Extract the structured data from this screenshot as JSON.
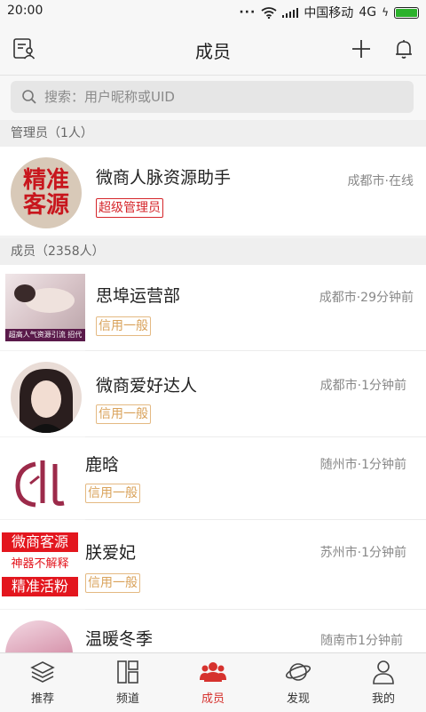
{
  "status_bar": {
    "time": "20:00",
    "carrier": "中国移动",
    "network": "4G"
  },
  "header": {
    "title": "成员"
  },
  "search": {
    "placeholder": "搜索：用户昵称或UID"
  },
  "sections": {
    "admins": "管理员（1人）",
    "members": "成员（2358人）"
  },
  "admin": {
    "avatar_text": [
      "精准",
      "客源"
    ],
    "name": "微商人脉资源助手",
    "meta": "成都市·在线",
    "badge": "超级管理员"
  },
  "members": [
    {
      "name": "思埠运营部",
      "meta": "成都市·29分钟前",
      "badge": "信用一般",
      "avatar_caption": "超高人气资源引流 招代"
    },
    {
      "name": "微商爱好达人",
      "meta": "成都市·1分钟前",
      "badge": "信用一般"
    },
    {
      "name": "鹿晗",
      "meta": "随州市·1分钟前",
      "badge": "信用一般"
    },
    {
      "name": "朕爱妃",
      "meta": "苏州市·1分钟前",
      "badge": "信用一般",
      "avatar_lines": [
        "微商客源",
        "神器不解释",
        "精准活粉"
      ]
    },
    {
      "name": "温暖冬季",
      "meta": "随南市1分钟前"
    }
  ],
  "tabbar": {
    "items": [
      {
        "label": "推荐",
        "icon": "layers-icon"
      },
      {
        "label": "频道",
        "icon": "grid-icon"
      },
      {
        "label": "成员",
        "icon": "group-icon",
        "active": true
      },
      {
        "label": "发现",
        "icon": "planet-icon"
      },
      {
        "label": "我的",
        "icon": "person-icon"
      }
    ]
  },
  "colors": {
    "accent": "#d6322e",
    "admin_badge": "#d5252a",
    "credit_badge": "#d9a25a"
  }
}
